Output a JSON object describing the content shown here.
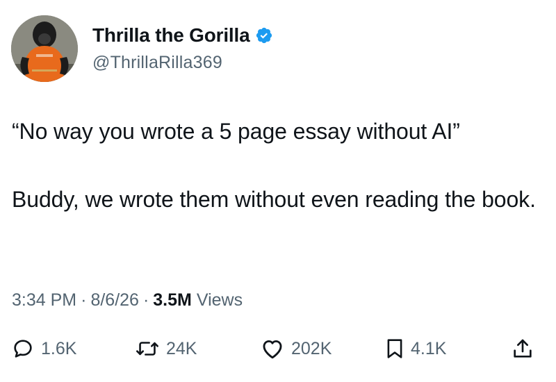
{
  "author": {
    "display_name": "Thrilla the Gorilla",
    "handle": "@ThrillaRilla369",
    "verified": true,
    "avatar_icon": "gorilla-avatar",
    "verified_color": "#1d9bf0"
  },
  "tweet": {
    "paragraphs": [
      "“No way you wrote a 5 page essay without AI”",
      "Buddy, we wrote them without even reading the book."
    ]
  },
  "meta": {
    "time": "3:34 PM",
    "separator": "·",
    "date": "8/6/26",
    "views_count": "3.5M",
    "views_label": "Views"
  },
  "actions": {
    "replies": "1.6K",
    "reposts": "24K",
    "likes": "202K",
    "bookmarks": "4.1K",
    "icons": [
      "reply-icon",
      "repost-icon",
      "like-icon",
      "bookmark-icon",
      "share-icon"
    ]
  },
  "colors": {
    "text_primary": "#0f1419",
    "text_secondary": "#536471",
    "accent": "#1d9bf0"
  }
}
